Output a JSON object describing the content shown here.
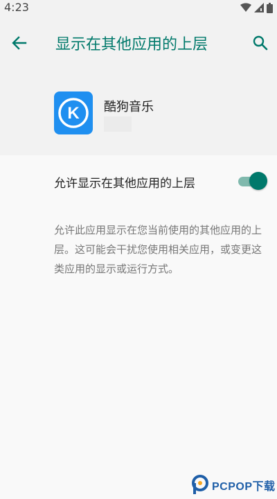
{
  "status_bar": {
    "time": "4:23",
    "icons": [
      "wifi-icon",
      "signal-icon",
      "battery-icon"
    ]
  },
  "app_bar": {
    "title": "显示在其他应用的上层",
    "back_icon": "back-arrow-icon",
    "search_icon": "search-icon",
    "accent_color": "#00796b"
  },
  "app_info": {
    "name": "酷狗音乐",
    "icon_letter": "K",
    "icon_color": "#1f8ff0"
  },
  "permission": {
    "label": "允许显示在其他应用的上层",
    "enabled": true
  },
  "description": "允许此应用显示在您当前使用的其他应用的上层。这可能会干扰您使用相关应用，或变更这类应用的显示或运行方式。",
  "watermark": {
    "text": "PCPOP下载"
  }
}
